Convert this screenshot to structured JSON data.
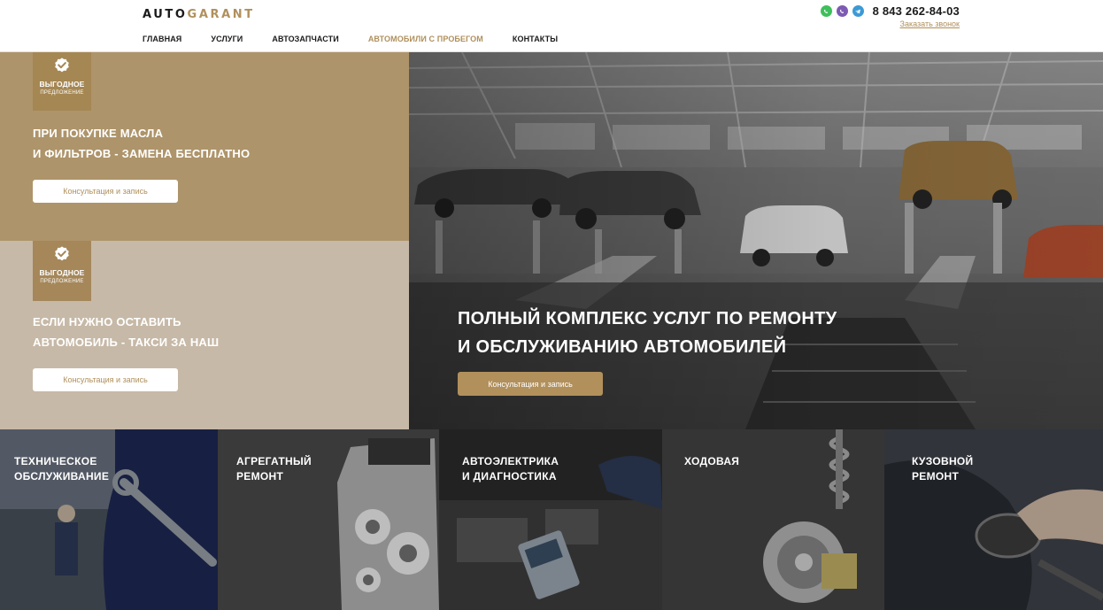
{
  "header": {
    "logo_auto": "AUTO",
    "logo_garant": "GARANT",
    "nav": [
      {
        "label": "ГЛАВНАЯ"
      },
      {
        "label": "УСЛУГИ"
      },
      {
        "label": "АВТОЗАПЧАСТИ"
      },
      {
        "label": "АВТОМОБИЛИ С ПРОБЕГОМ"
      },
      {
        "label": "КОНТАКТЫ"
      }
    ],
    "phone": "8 843 262-84-03",
    "callback": "Заказать звонок",
    "messengers": [
      "whatsapp-icon",
      "viber-icon",
      "telegram-icon"
    ]
  },
  "offers": [
    {
      "badge_main": "ВЫГОДНОЕ",
      "badge_sub": "ПРЕДЛОЖЕНИЕ",
      "title_line1": "ПРИ ПОКУПКЕ МАСЛА",
      "title_line2": "И ФИЛЬТРОВ - ЗАМЕНА БЕСПЛАТНО",
      "button": "Консультация и запись"
    },
    {
      "badge_main": "ВЫГОДНОЕ",
      "badge_sub": "ПРЕДЛОЖЕНИЕ",
      "title_line1": "ЕСЛИ НУЖНО ОСТАВИТЬ",
      "title_line2": "АВТОМОБИЛЬ - ТАКСИ ЗА НАШ",
      "button": "Консультация и запись"
    }
  ],
  "hero": {
    "title_line1": "ПОЛНЫЙ КОМПЛЕКС УСЛУГ ПО РЕМОНТУ",
    "title_line2": "И ОБСЛУЖИВАНИЮ АВТОМОБИЛЕЙ",
    "button": "Консультация и запись"
  },
  "services": [
    {
      "line1": "ТЕХНИЧЕСКОЕ",
      "line2": "ОБСЛУЖИВАНИЕ"
    },
    {
      "line1": "АГРЕГАТНЫЙ",
      "line2": "РЕМОНТ"
    },
    {
      "line1": "АВТОЭЛЕКТРИКА",
      "line2": "И ДИАГНОСТИКА"
    },
    {
      "line1": "ХОДОВАЯ",
      "line2": ""
    },
    {
      "line1": "КУЗОВНОЙ",
      "line2": "РЕМОНТ"
    }
  ],
  "colors": {
    "accent": "#b0905c",
    "offer1_bg": "#ae946a",
    "offer2_bg": "#c7b9a7",
    "text_dark": "#1b1b1b"
  }
}
